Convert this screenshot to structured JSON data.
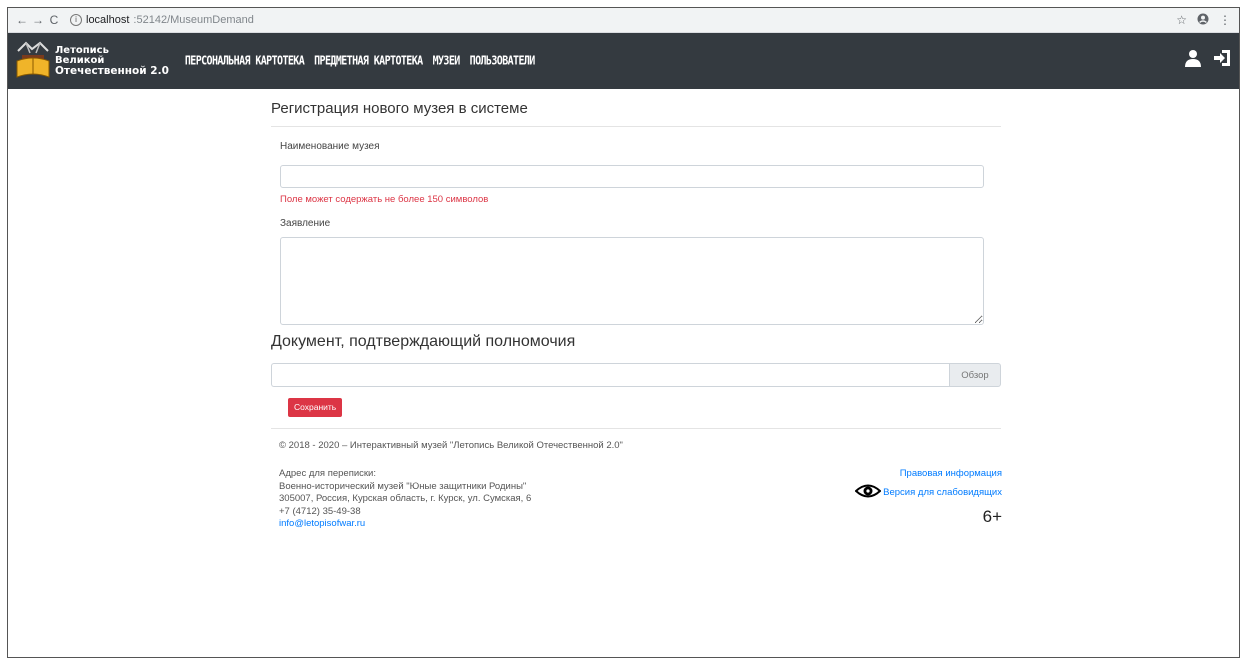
{
  "browser": {
    "back": "←",
    "forward": "→",
    "reload": "C",
    "url_host": "localhost",
    "url_path": ":52142/MuseumDemand"
  },
  "app": {
    "logo_line1": "Летопись",
    "logo_line2": "Великой",
    "logo_line3": "Отечественной 2.0",
    "menu": [
      {
        "label": "ПЕРСОНАЛЬНАЯ КАРТОТЕКА"
      },
      {
        "label": "ПРЕДМЕТНАЯ КАРТОТЕКА"
      },
      {
        "label": "МУЗЕИ"
      },
      {
        "label": "ПОЛЬЗОВАТЕЛИ"
      }
    ]
  },
  "form": {
    "title": "Регистрация нового музея в системе",
    "name_label": "Наименование музея",
    "name_value": "",
    "name_error": "Поле может содержать не более 150 символов",
    "statement_label": "Заявление",
    "statement_value": "",
    "document_title": "Документ, подтверждающий полномочия",
    "browse_label": "Обзор",
    "save_label": "Сохранить"
  },
  "footer": {
    "copyright": "© 2018 - 2020 – Интерактивный музей \"Летопись Великой Отечественной 2.0\"",
    "address_label": "Адрес для переписки:",
    "address_org": "Военно-исторический музей \"Юные защитники Родины\"",
    "address_street": "305007, Россия, Курская область, г. Курск, ул. Сумская, 6",
    "phone": "+7 (4712) 35-49-38",
    "email": "info@letopisofwar.ru",
    "legal_link": "Правовая информация",
    "accessibility_link": "Версия для слабовидящих",
    "age_rating": "6+"
  },
  "colors": {
    "navbar": "#343a40",
    "danger": "#dc3545",
    "link": "#007bff"
  }
}
